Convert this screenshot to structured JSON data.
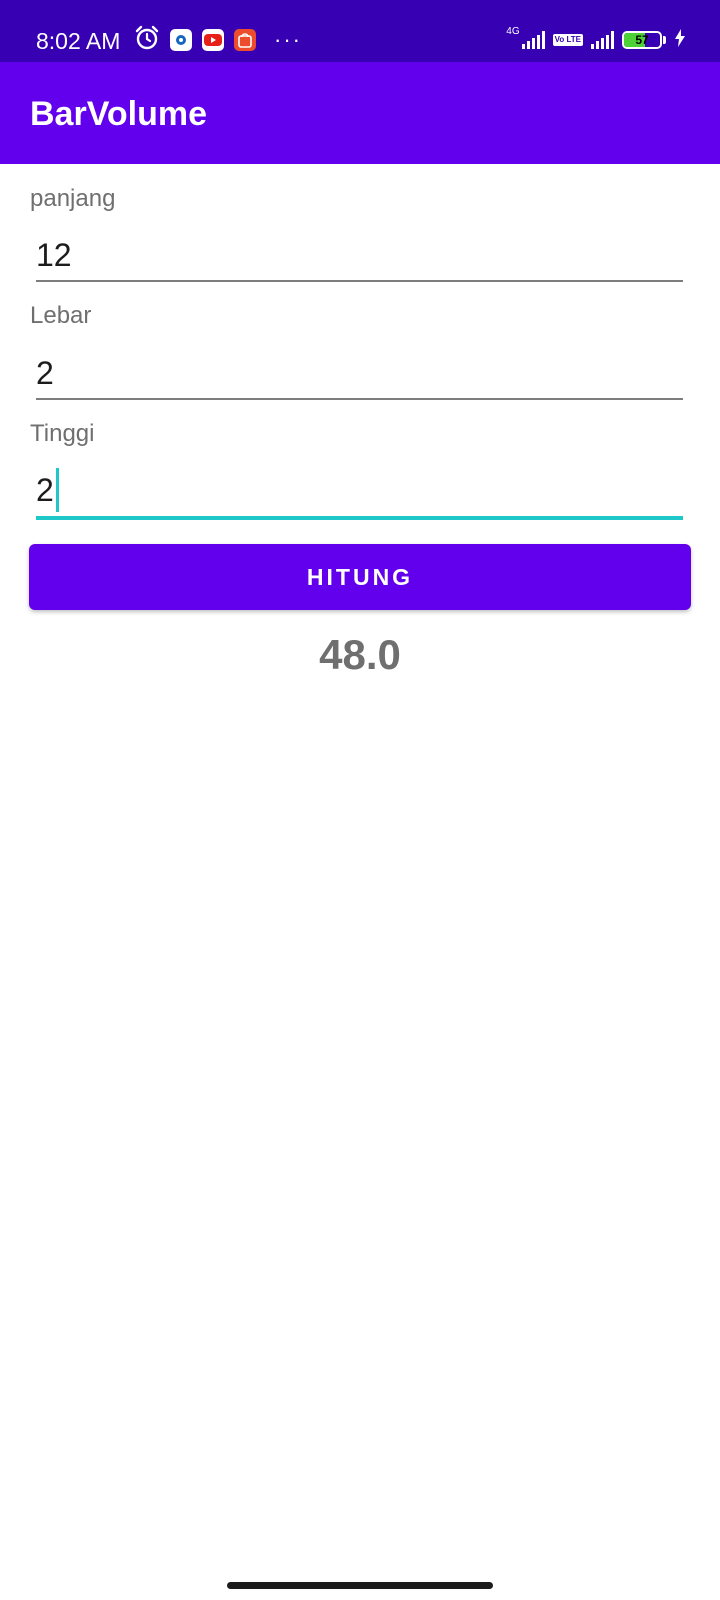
{
  "status_bar": {
    "time": "8:02 AM",
    "network_label": "4G",
    "volte_label": "Vo LTE",
    "battery_level": "57",
    "battery_fraction": 0.57,
    "charging": true,
    "icons": [
      "alarm-icon",
      "app-notification-icon",
      "youtube-icon",
      "shopee-icon",
      "more-notifications-icon",
      "signal-icon",
      "volte-icon",
      "battery-icon",
      "charging-icon"
    ]
  },
  "app_bar": {
    "title": "BarVolume"
  },
  "form": {
    "length_label": "panjang",
    "length_value": "12",
    "width_label": "Lebar",
    "width_value": "2",
    "height_label": "Tinggi",
    "height_value": "2",
    "calculate_button": "HITUNG"
  },
  "result": {
    "value": "48.0"
  },
  "colors": {
    "status_bar": "#3700b3",
    "primary": "#6200ee",
    "accent": "#1fc8c8",
    "label_gray": "#6f6f6f",
    "result_gray": "#6f6f6f"
  }
}
